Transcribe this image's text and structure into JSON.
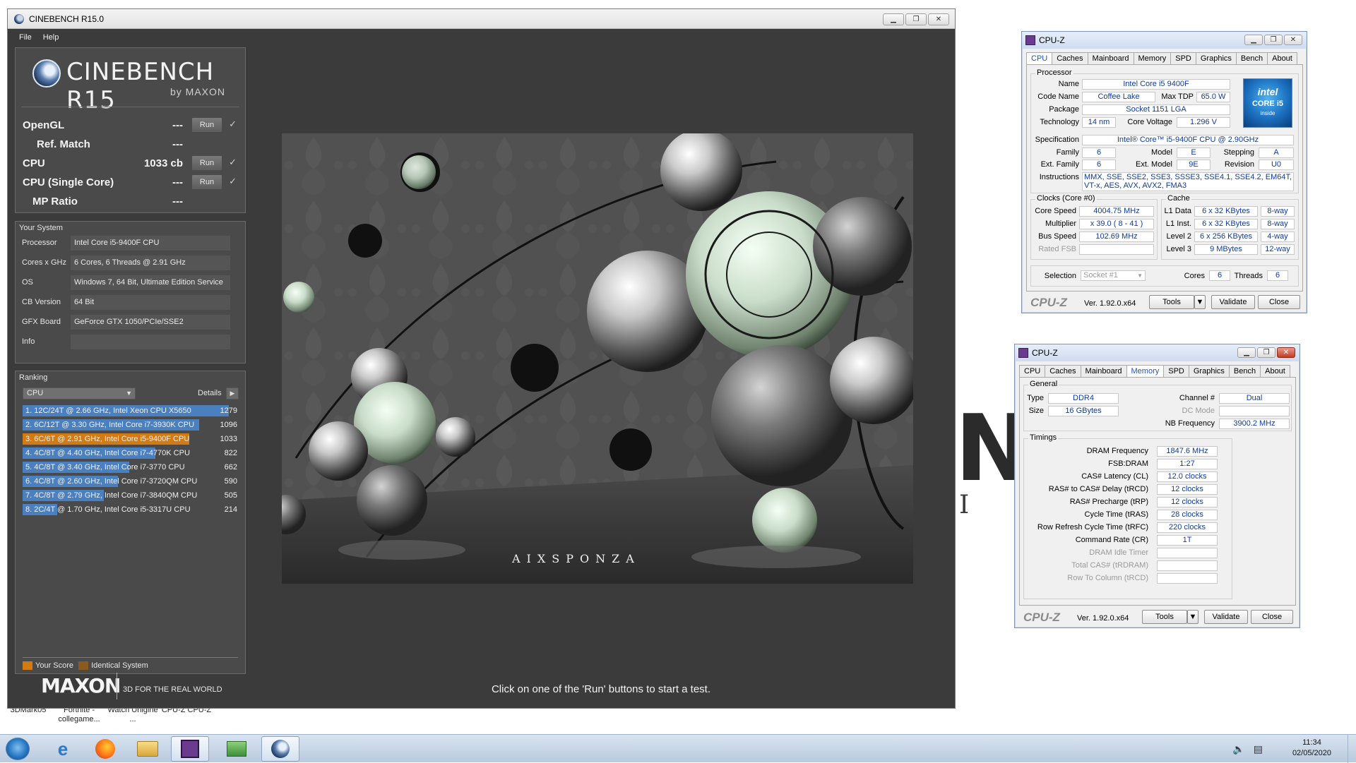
{
  "desktop": {
    "wallpaper_big": "NI",
    "wallpaper_small": "I O",
    "icon_labels": [
      "3DMark05",
      "Fortnite - collegame...",
      "Watch Unigine ...",
      "CPU-Z CPU-Z"
    ]
  },
  "cinebench": {
    "window_title": "CINEBENCH R15.0",
    "menu": [
      "File",
      "Help"
    ],
    "logo_text": "CINEBENCH R15",
    "logo_sub": "by MAXON",
    "run_label": "Run",
    "check_mark": "✓",
    "tests": [
      {
        "label": "OpenGL",
        "value": "---",
        "has_run": true
      },
      {
        "label": "Ref. Match",
        "value": "---",
        "has_run": false
      },
      {
        "label": "CPU",
        "value": "1033 cb",
        "has_run": true
      },
      {
        "label": "CPU (Single Core)",
        "value": "---",
        "has_run": true
      },
      {
        "label": "MP Ratio",
        "value": "---",
        "has_run": false
      }
    ],
    "your_system": {
      "title": "Your System",
      "rows": [
        {
          "k": "Processor",
          "v": "Intel Core i5-9400F CPU"
        },
        {
          "k": "Cores x GHz",
          "v": "6 Cores, 6 Threads @ 2.91 GHz"
        },
        {
          "k": "OS",
          "v": "Windows 7, 64 Bit, Ultimate Edition Service"
        },
        {
          "k": "CB Version",
          "v": "64 Bit"
        },
        {
          "k": "GFX Board",
          "v": "GeForce GTX 1050/PCIe/SSE2"
        },
        {
          "k": "Info",
          "v": ""
        }
      ]
    },
    "ranking": {
      "title": "Ranking",
      "select": "CPU",
      "details": "Details",
      "max_score": 1279,
      "rows": [
        {
          "text": "1. 12C/24T @ 2.66 GHz, Intel Xeon CPU X5650",
          "score": 1279,
          "color": "#4a7fc0"
        },
        {
          "text": "2. 6C/12T @ 3.30 GHz,  Intel Core i7-3930K CPU",
          "score": 1096,
          "color": "#4a7fc0"
        },
        {
          "text": "3. 6C/6T @ 2.91 GHz, Intel Core i5-9400F CPU",
          "score": 1033,
          "color": "#d27a14"
        },
        {
          "text": "4. 4C/8T @ 4.40 GHz, Intel Core i7-4770K CPU",
          "score": 822,
          "color": "#4a7fc0"
        },
        {
          "text": "5. 4C/8T @ 3.40 GHz,  Intel Core i7-3770 CPU",
          "score": 662,
          "color": "#4a7fc0"
        },
        {
          "text": "6. 4C/8T @ 2.60 GHz, Intel Core i7-3720QM CPU",
          "score": 590,
          "color": "#4a7fc0"
        },
        {
          "text": "7. 4C/8T @ 2.79 GHz,  Intel Core i7-3840QM CPU",
          "score": 505,
          "color": "#4a7fc0"
        },
        {
          "text": "8. 2C/4T @ 1.70 GHz,  Intel Core i5-3317U CPU",
          "score": 214,
          "color": "#4a7fc0"
        }
      ],
      "legend_your": "Your Score",
      "legend_identical": "Identical System",
      "legend_your_color": "#d27a14",
      "legend_identical_color": "#8a5a1e"
    },
    "footer_logo": "MAXON",
    "footer_tag": "3D FOR THE REAL WORLD",
    "status": "Click on one of the 'Run' buttons to start a test.",
    "render_watermark": "AIXSPONZA"
  },
  "cpuz1": {
    "title": "CPU-Z",
    "tabs": [
      "CPU",
      "Caches",
      "Mainboard",
      "Memory",
      "SPD",
      "Graphics",
      "Bench",
      "About"
    ],
    "active_tab": "CPU",
    "processor_title": "Processor",
    "name_lbl": "Name",
    "name": "Intel Core i5 9400F",
    "codename_lbl": "Code Name",
    "codename": "Coffee Lake",
    "maxtdp_lbl": "Max TDP",
    "maxtdp": "65.0 W",
    "package_lbl": "Package",
    "package": "Socket 1151 LGA",
    "tech_lbl": "Technology",
    "tech": "14 nm",
    "voltage_lbl": "Core Voltage",
    "voltage": "1.296 V",
    "spec_lbl": "Specification",
    "spec": "Intel® Core™ i5-9400F CPU @ 2.90GHz",
    "family_lbl": "Family",
    "family": "6",
    "model_lbl": "Model",
    "model": "E",
    "stepping_lbl": "Stepping",
    "stepping": "A",
    "extfamily_lbl": "Ext. Family",
    "extfamily": "6",
    "extmodel_lbl": "Ext. Model",
    "extmodel": "9E",
    "revision_lbl": "Revision",
    "revision": "U0",
    "instr_lbl": "Instructions",
    "instr": "MMX, SSE, SSE2, SSE3, SSSE3, SSE4.1, SSE4.2, EM64T, VT-x, AES, AVX, AVX2, FMA3",
    "clocks_title": "Clocks (Core #0)",
    "corespeed_lbl": "Core Speed",
    "corespeed": "4004.75 MHz",
    "multiplier_lbl": "Multiplier",
    "multiplier": "x 39.0 ( 8 - 41 )",
    "busspeed_lbl": "Bus Speed",
    "busspeed": "102.69 MHz",
    "ratedfsb_lbl": "Rated FSB",
    "ratedfsb": "",
    "cache_title": "Cache",
    "l1d_lbl": "L1 Data",
    "l1d": "6 x 32 KBytes",
    "l1d_way": "8-way",
    "l1i_lbl": "L1 Inst.",
    "l1i": "6 x 32 KBytes",
    "l1i_way": "8-way",
    "l2_lbl": "Level 2",
    "l2": "6 x 256 KBytes",
    "l2_way": "4-way",
    "l3_lbl": "Level 3",
    "l3": "9 MBytes",
    "l3_way": "12-way",
    "selection_lbl": "Selection",
    "selection": "Socket #1",
    "cores_lbl": "Cores",
    "cores": "6",
    "threads_lbl": "Threads",
    "threads": "6",
    "version": "Ver. 1.92.0.x64",
    "tools": "Tools",
    "validate": "Validate",
    "close": "Close",
    "foot_logo": "CPU-Z",
    "intel_1": "intel",
    "intel_2": "CORE i5",
    "intel_3": "inside"
  },
  "cpuz2": {
    "title": "CPU-Z",
    "tabs": [
      "CPU",
      "Caches",
      "Mainboard",
      "Memory",
      "SPD",
      "Graphics",
      "Bench",
      "About"
    ],
    "active_tab": "Memory",
    "general_title": "General",
    "type_lbl": "Type",
    "type": "DDR4",
    "size_lbl": "Size",
    "size": "16 GBytes",
    "channel_lbl": "Channel #",
    "channel": "Dual",
    "dcmode_lbl": "DC Mode",
    "dcmode": "",
    "nbfreq_lbl": "NB Frequency",
    "nbfreq": "3900.2 MHz",
    "timings_title": "Timings",
    "timings": [
      {
        "k": "DRAM Frequency",
        "v": "1847.6 MHz",
        "gray": false
      },
      {
        "k": "FSB:DRAM",
        "v": "1:27",
        "gray": false
      },
      {
        "k": "CAS# Latency (CL)",
        "v": "12.0 clocks",
        "gray": false
      },
      {
        "k": "RAS# to CAS# Delay (tRCD)",
        "v": "12 clocks",
        "gray": false
      },
      {
        "k": "RAS# Precharge (tRP)",
        "v": "12 clocks",
        "gray": false
      },
      {
        "k": "Cycle Time (tRAS)",
        "v": "28 clocks",
        "gray": false
      },
      {
        "k": "Row Refresh Cycle Time (tRFC)",
        "v": "220 clocks",
        "gray": false
      },
      {
        "k": "Command Rate (CR)",
        "v": "1T",
        "gray": false
      },
      {
        "k": "DRAM Idle Timer",
        "v": "",
        "gray": true
      },
      {
        "k": "Total CAS# (tRDRAM)",
        "v": "",
        "gray": true
      },
      {
        "k": "Row To Column (tRCD)",
        "v": "",
        "gray": true
      }
    ],
    "version": "Ver. 1.92.0.x64",
    "tools": "Tools",
    "validate": "Validate",
    "close": "Close",
    "foot_logo": "CPU-Z"
  },
  "taskbar": {
    "time": "11:34",
    "date": "02/05/2020"
  }
}
